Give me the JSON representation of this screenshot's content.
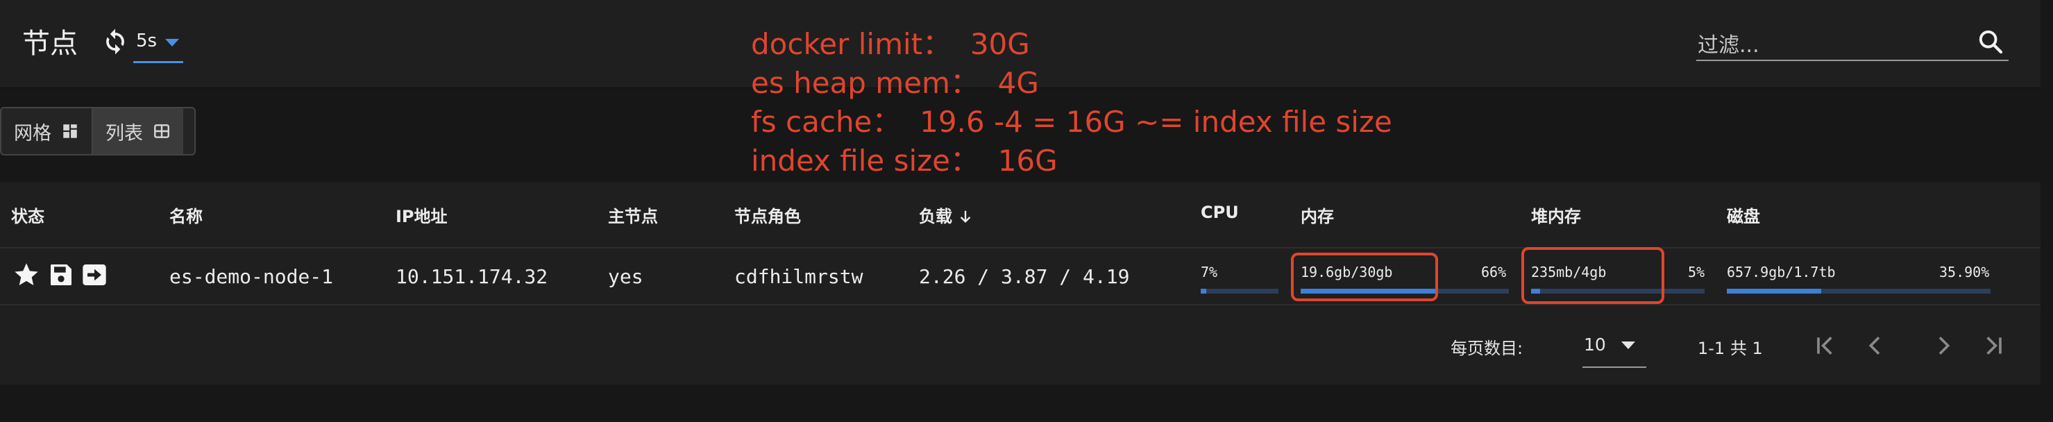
{
  "header": {
    "title": "节点",
    "refresh_interval": "5s",
    "filter_placeholder": "过滤..."
  },
  "annotations": [
    "docker limit：  30G",
    "es heap mem：  4G",
    "fs cache：  19.6 -4 = 16G ~= index file size",
    "index file size：  16G"
  ],
  "view_toggle": {
    "grid_label": "网格",
    "list_label": "列表"
  },
  "table": {
    "columns": {
      "status": "状态",
      "name": "名称",
      "ip": "IP地址",
      "master": "主节点",
      "roles": "节点角色",
      "load": "负载",
      "cpu": "CPU",
      "memory": "内存",
      "heap": "堆内存",
      "disk": "磁盘"
    },
    "rows": [
      {
        "name": "es-demo-node-1",
        "ip": "10.151.174.32",
        "master": "yes",
        "roles": "cdfhilmrstw",
        "load": "2.26 / 3.87 / 4.19",
        "cpu": {
          "percent_label": "7%",
          "fraction": 0.07
        },
        "memory": {
          "used_label": "19.6gb/30gb",
          "percent_label": "66%",
          "fraction": 0.66
        },
        "heap": {
          "used_label": "235mb/4gb",
          "percent_label": "5%",
          "fraction": 0.05
        },
        "disk": {
          "used_label": "657.9gb/1.7tb",
          "percent_label": "35.90%",
          "fraction": 0.359
        }
      }
    ]
  },
  "pagination": {
    "rows_per_page_label": "每页数目:",
    "rows_per_page_value": "10",
    "range_text": "1-1 共 1"
  },
  "colors": {
    "accent": "#4a90e2",
    "annotation": "#e0452e",
    "bar_fill": "#3d7fd9",
    "bar_track": "#2b3e5c"
  }
}
